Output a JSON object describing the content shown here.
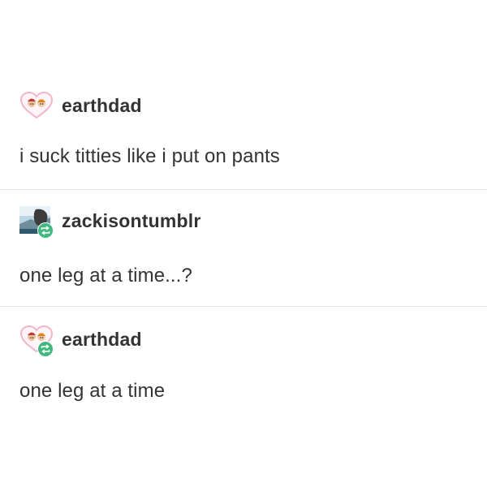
{
  "posts": [
    {
      "username": "earthdad",
      "text": "i suck titties like i put on pants",
      "avatar_icon": "heart-avatar-icon",
      "reblogged": false
    },
    {
      "username": "zackisontumblr",
      "text": "one leg at a time...?",
      "avatar_icon": "photo-avatar-icon",
      "reblogged": true
    },
    {
      "username": "earthdad",
      "text": "one leg at a time",
      "avatar_icon": "heart-avatar-icon",
      "reblogged": true
    }
  ],
  "colors": {
    "reblog_badge": "#3fb97f",
    "heart_outline": "#f2b6c9",
    "divider": "#e6e6e6"
  }
}
